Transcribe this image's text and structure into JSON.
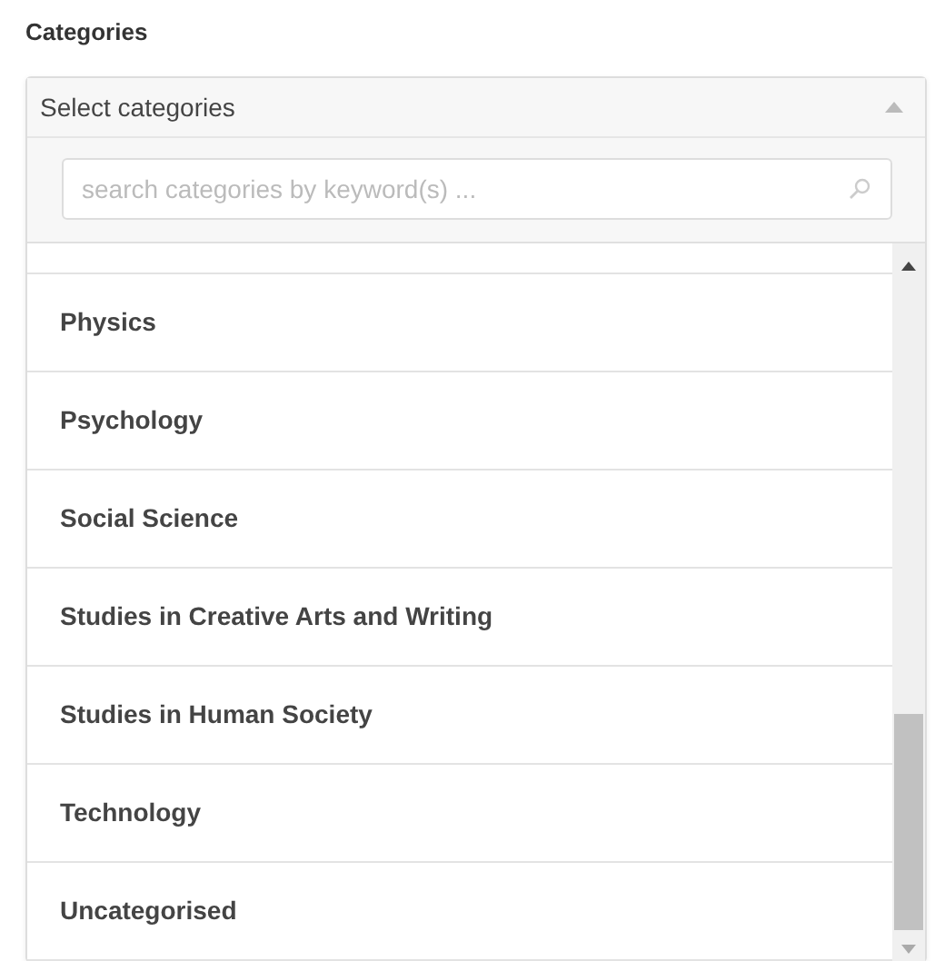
{
  "label": "Categories",
  "select": {
    "value": "Select categories",
    "expanded": true
  },
  "search": {
    "placeholder": "search categories by keyword(s) ..."
  },
  "options": [
    {
      "label": "Physics"
    },
    {
      "label": "Psychology"
    },
    {
      "label": "Social Science"
    },
    {
      "label": "Studies in Creative Arts and Writing"
    },
    {
      "label": "Studies in Human Society"
    },
    {
      "label": "Technology"
    },
    {
      "label": "Uncategorised"
    }
  ]
}
